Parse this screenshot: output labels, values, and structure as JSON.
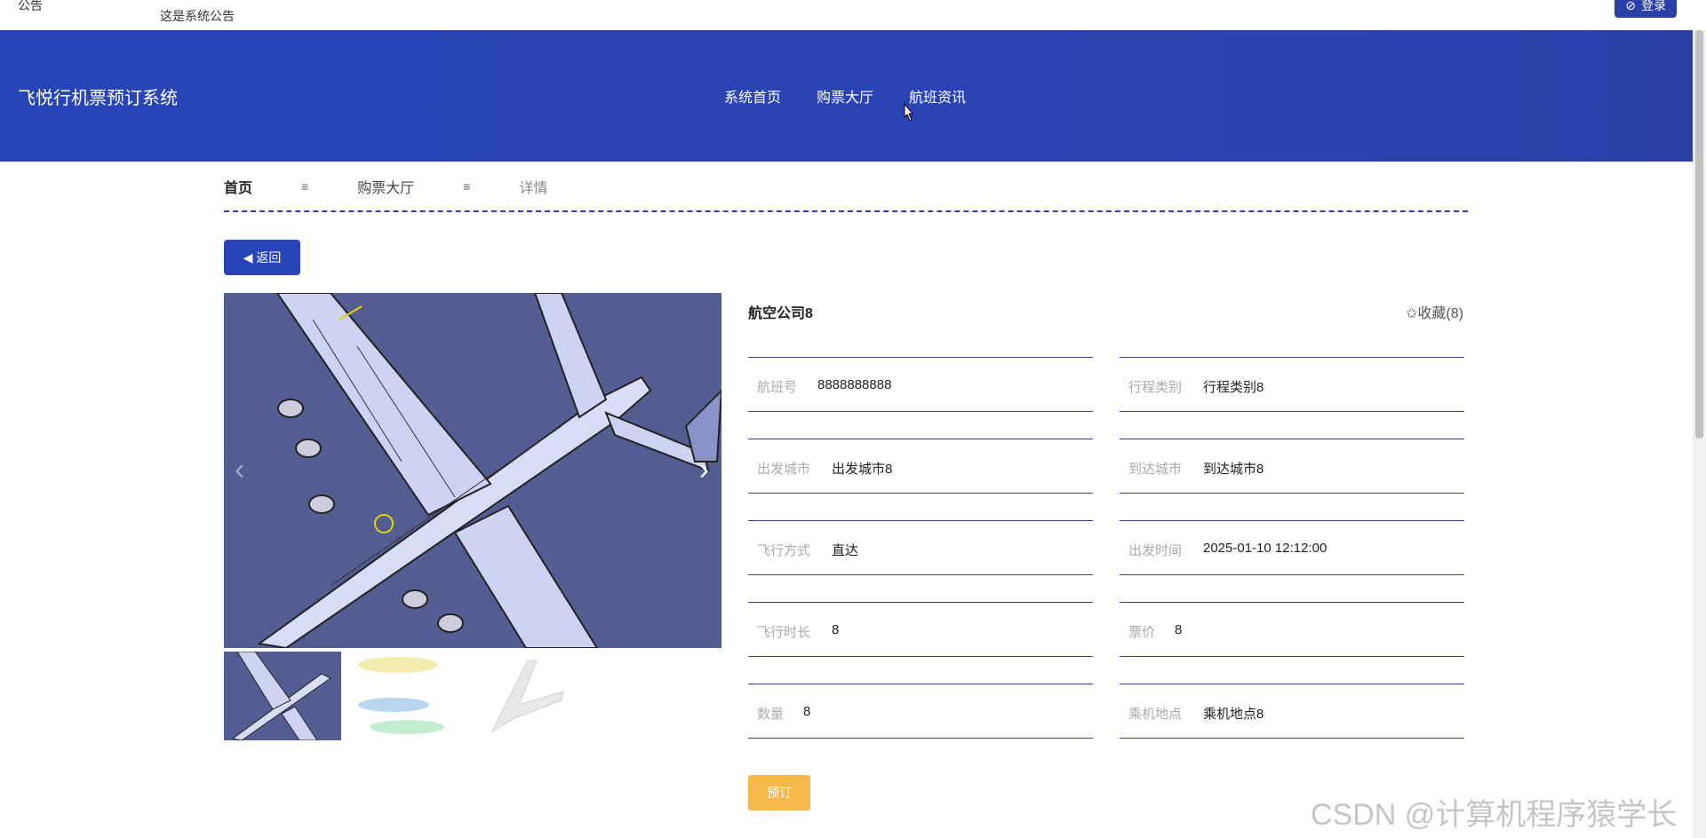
{
  "notice": {
    "label": "公告",
    "text": "这是系统公告"
  },
  "auth": {
    "login_label": "登录"
  },
  "header": {
    "brand": "飞悦行机票预订系统"
  },
  "nav": [
    {
      "label": "系统首页"
    },
    {
      "label": "购票大厅"
    },
    {
      "label": "航班资讯"
    }
  ],
  "breadcrumb": {
    "home": "首页",
    "separator": "≡",
    "hall": "购票大厅",
    "current": "详情"
  },
  "back_button": {
    "label": "返回"
  },
  "detail": {
    "title": "航空公司8",
    "favorite_label": "✩收藏(8)",
    "fields": [
      {
        "label": "航班号",
        "value": "8888888888"
      },
      {
        "label": "行程类别",
        "value": "行程类别8"
      },
      {
        "label": "出发城市",
        "value": "出发城市8"
      },
      {
        "label": "到达城市",
        "value": "到达城市8"
      },
      {
        "label": "飞行方式",
        "value": "直达"
      },
      {
        "label": "出发时间",
        "value": "2025-01-10 12:12:00"
      },
      {
        "label": "飞行时长",
        "value": "8"
      },
      {
        "label": "票价",
        "value": "8"
      },
      {
        "label": "数量",
        "value": "8"
      },
      {
        "label": "乘机地点",
        "value": "乘机地点8"
      }
    ],
    "book_label": "预订"
  },
  "carousel": {
    "thumb_count": 3
  },
  "watermark": "CSDN @计算机程序猿学长",
  "colors": {
    "primary": "#2845b8",
    "book": "#f6b84a",
    "rule": "#3a3f8f"
  }
}
